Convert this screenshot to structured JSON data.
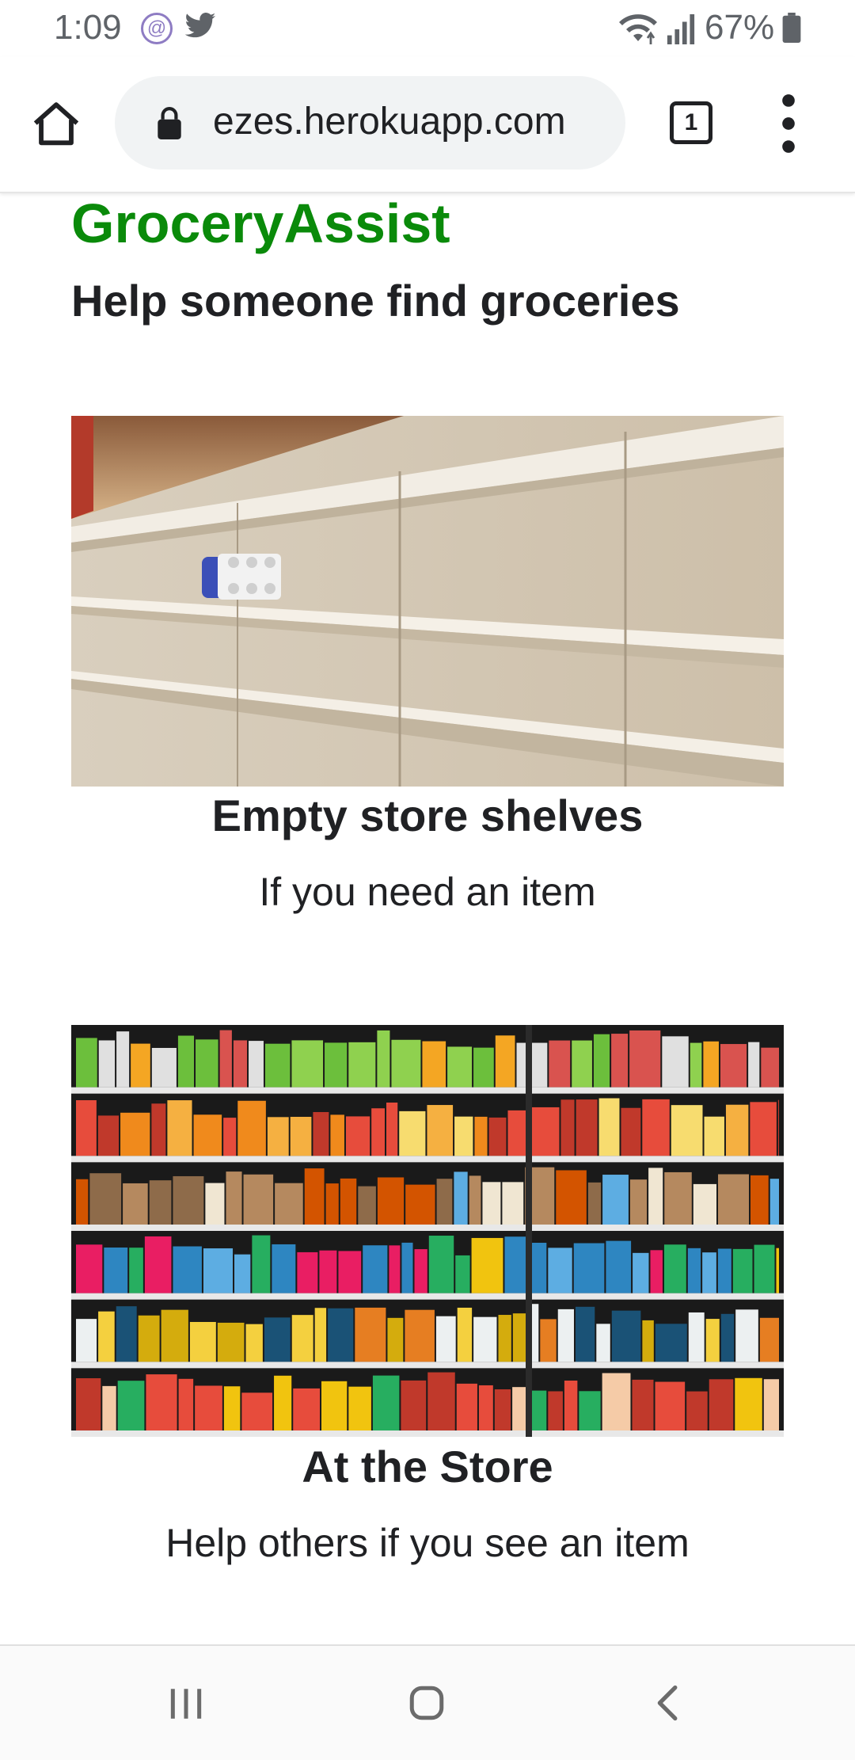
{
  "status": {
    "time": "1:09",
    "battery": "67%",
    "icons": [
      "threads-icon",
      "twitter-icon",
      "wifi-icon",
      "signal-icon",
      "battery-icon"
    ]
  },
  "browser": {
    "url": "ezes.herokuapp.com",
    "tab_count": "1"
  },
  "page": {
    "title": "GroceryAssist",
    "subtitle": "Help someone find groceries",
    "title_color": "#0a8a0a",
    "cards": [
      {
        "title": "Empty store shelves",
        "description": "If you need an item"
      },
      {
        "title": "At the Store",
        "description": "Help others if you see an item"
      }
    ]
  },
  "navbar": {
    "icons": [
      "recents-icon",
      "home-circle-icon",
      "back-icon"
    ]
  }
}
